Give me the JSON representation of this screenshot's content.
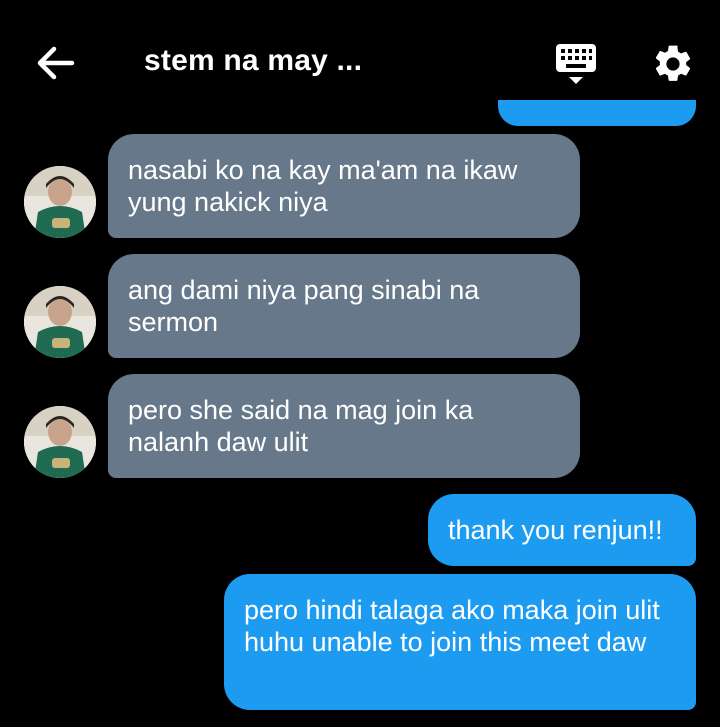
{
  "header": {
    "title": "stem na may ...",
    "back_icon": "arrow-left-icon",
    "keyboard_icon": "keyboard-icon",
    "settings_icon": "gear-icon"
  },
  "messages": [
    {
      "direction": "incoming",
      "text": "nasabi ko na kay ma'am na ikaw yung nakick niya"
    },
    {
      "direction": "incoming",
      "text": "ang dami niya pang sinabi na sermon"
    },
    {
      "direction": "incoming",
      "text": "pero she said na mag join ka nalanh daw ulit"
    },
    {
      "direction": "outgoing",
      "text": "thank you renjun!!"
    },
    {
      "direction": "outgoing",
      "text": "pero hindi talaga ako maka join ulit huhu unable to join this meet daw"
    }
  ],
  "colors": {
    "background": "#000000",
    "incoming_bubble": "#66788a",
    "outgoing_bubble": "#1d9bf0"
  }
}
